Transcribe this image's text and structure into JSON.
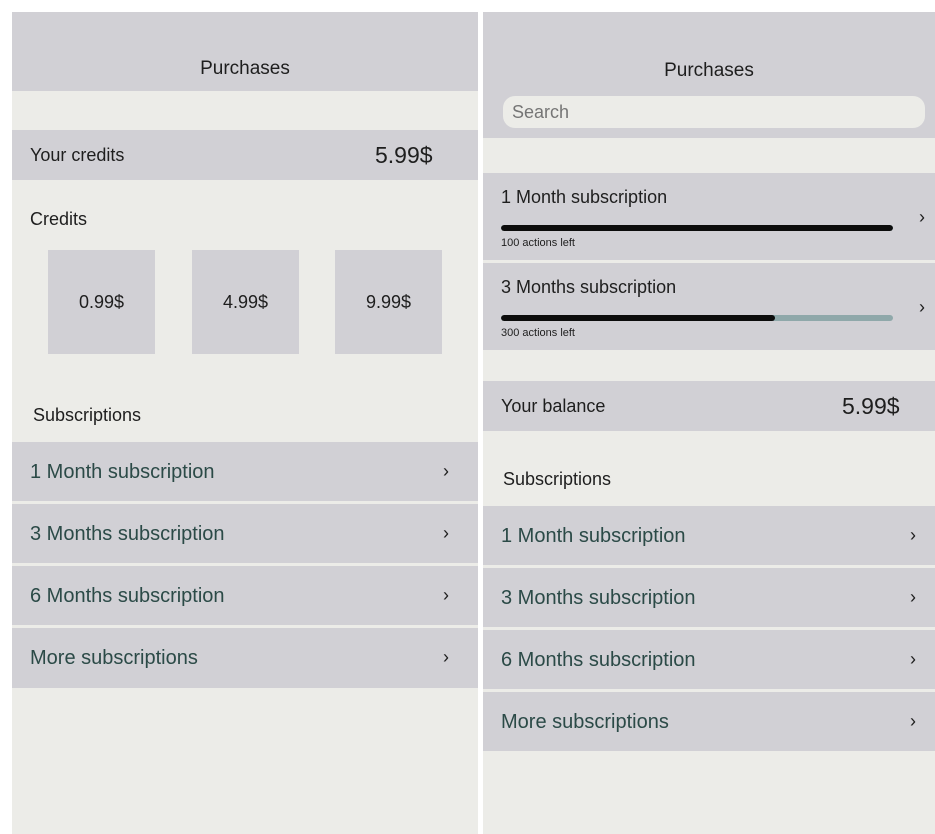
{
  "left": {
    "header": {
      "title": "Purchases"
    },
    "credits_bar": {
      "label": "Your credits",
      "amount": "5.99$"
    },
    "credits_section": {
      "title": "Credits",
      "options": [
        "0.99$",
        "4.99$",
        "9.99$"
      ]
    },
    "subscriptions_section": {
      "title": "Subscriptions",
      "items": [
        {
          "label": "1 Month subscription"
        },
        {
          "label": "3 Months subscription"
        },
        {
          "label": "6 Months subscription"
        },
        {
          "label": "More subscriptions"
        }
      ]
    }
  },
  "right": {
    "header": {
      "title": "Purchases"
    },
    "search": {
      "placeholder": "Search"
    },
    "active_subscriptions": [
      {
        "title": "1 Month subscription",
        "subtitle": "100 actions left",
        "progress": 1.0
      },
      {
        "title": "3 Months subscription",
        "subtitle": "300 actions left",
        "progress": 0.7
      }
    ],
    "balance_bar": {
      "label": "Your balance",
      "amount": "5.99$"
    },
    "subscriptions_section": {
      "title": "Subscriptions",
      "items": [
        {
          "label": "1 Month subscription"
        },
        {
          "label": "3 Months subscription"
        },
        {
          "label": "6 Months subscription"
        },
        {
          "label": "More subscriptions"
        }
      ]
    }
  },
  "icons": {
    "chevron": "chevron-right-icon",
    "chevron_glyph": "›"
  },
  "colors": {
    "panel_bg": "#ecece8",
    "bar_bg": "#d1d0d5",
    "list_text": "#2b4a47",
    "progress_fill": "#0c0c0c",
    "progress_track": "#8fa8aa"
  }
}
